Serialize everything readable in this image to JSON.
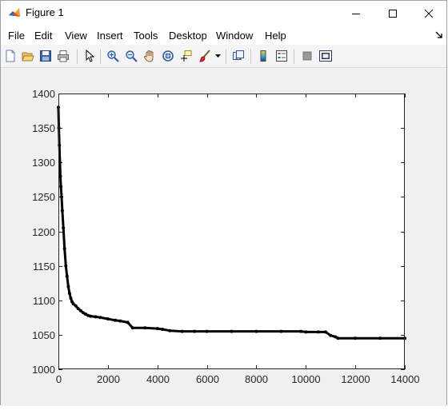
{
  "window": {
    "title": "Figure 1"
  },
  "menu": {
    "items": [
      "File",
      "Edit",
      "View",
      "Insert",
      "Tools",
      "Desktop",
      "Window",
      "Help"
    ]
  },
  "toolbar": {
    "icons": [
      "new-figure-icon",
      "open-file-icon",
      "save-icon",
      "print-icon",
      "pointer-icon",
      "zoom-in-icon",
      "zoom-out-icon",
      "pan-icon",
      "rotate-3d-icon",
      "data-cursor-icon",
      "brush-icon",
      "link-plot-icon",
      "colorbar-icon",
      "legend-icon",
      "hide-plot-tools-icon",
      "show-plot-tools-icon"
    ]
  },
  "colors": {
    "axes_background": "#ffffff",
    "figure_background": "#f0f0f0",
    "line": "#000000"
  },
  "chart_data": {
    "type": "line",
    "title": "",
    "xlabel": "",
    "ylabel": "",
    "xlim": [
      0,
      14000
    ],
    "ylim": [
      1000,
      1400
    ],
    "xticks": [
      0,
      2000,
      4000,
      6000,
      8000,
      10000,
      12000,
      14000
    ],
    "xtick_labels": [
      "0",
      "2000",
      "4000",
      "6000",
      "8000",
      "10000",
      "12000",
      "14000"
    ],
    "yticks": [
      1000,
      1050,
      1100,
      1150,
      1200,
      1250,
      1300,
      1350,
      1400
    ],
    "ytick_labels": [
      "1000",
      "1050",
      "1100",
      "1150",
      "1200",
      "1250",
      "1300",
      "1350",
      "1400"
    ],
    "grid": false,
    "marker": "dot",
    "series": [
      {
        "x": [
          0,
          20,
          40,
          60,
          80,
          100,
          130,
          160,
          200,
          250,
          300,
          350,
          400,
          450,
          500,
          550,
          600,
          700,
          800,
          900,
          1000,
          1100,
          1200,
          1300,
          1500,
          1700,
          2000,
          2300,
          2500,
          2800,
          3000,
          3500,
          4000,
          4200,
          4500,
          5000,
          5500,
          6000,
          7000,
          8000,
          9000,
          9800,
          10000,
          10500,
          10800,
          11000,
          11200,
          11300,
          12000,
          13000,
          14000
        ],
        "y": [
          1380,
          1350,
          1325,
          1300,
          1280,
          1265,
          1250,
          1230,
          1205,
          1175,
          1150,
          1135,
          1120,
          1110,
          1103,
          1098,
          1095,
          1092,
          1088,
          1085,
          1082,
          1080,
          1078,
          1077,
          1076,
          1075,
          1073,
          1071,
          1070,
          1068,
          1060,
          1060,
          1059,
          1058,
          1056,
          1055,
          1055,
          1055,
          1055,
          1055,
          1055,
          1055,
          1054,
          1054,
          1054,
          1049,
          1047,
          1045,
          1045,
          1045,
          1045
        ]
      }
    ]
  }
}
